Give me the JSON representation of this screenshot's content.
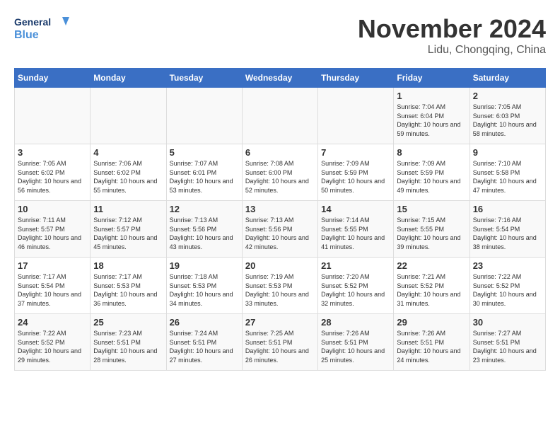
{
  "header": {
    "logo_line1": "General",
    "logo_line2": "Blue",
    "month": "November 2024",
    "location": "Lidu, Chongqing, China"
  },
  "weekdays": [
    "Sunday",
    "Monday",
    "Tuesday",
    "Wednesday",
    "Thursday",
    "Friday",
    "Saturday"
  ],
  "weeks": [
    [
      {
        "day": "",
        "sunrise": "",
        "sunset": "",
        "daylight": ""
      },
      {
        "day": "",
        "sunrise": "",
        "sunset": "",
        "daylight": ""
      },
      {
        "day": "",
        "sunrise": "",
        "sunset": "",
        "daylight": ""
      },
      {
        "day": "",
        "sunrise": "",
        "sunset": "",
        "daylight": ""
      },
      {
        "day": "",
        "sunrise": "",
        "sunset": "",
        "daylight": ""
      },
      {
        "day": "1",
        "sunrise": "Sunrise: 7:04 AM",
        "sunset": "Sunset: 6:04 PM",
        "daylight": "Daylight: 10 hours and 59 minutes."
      },
      {
        "day": "2",
        "sunrise": "Sunrise: 7:05 AM",
        "sunset": "Sunset: 6:03 PM",
        "daylight": "Daylight: 10 hours and 58 minutes."
      }
    ],
    [
      {
        "day": "3",
        "sunrise": "Sunrise: 7:05 AM",
        "sunset": "Sunset: 6:02 PM",
        "daylight": "Daylight: 10 hours and 56 minutes."
      },
      {
        "day": "4",
        "sunrise": "Sunrise: 7:06 AM",
        "sunset": "Sunset: 6:02 PM",
        "daylight": "Daylight: 10 hours and 55 minutes."
      },
      {
        "day": "5",
        "sunrise": "Sunrise: 7:07 AM",
        "sunset": "Sunset: 6:01 PM",
        "daylight": "Daylight: 10 hours and 53 minutes."
      },
      {
        "day": "6",
        "sunrise": "Sunrise: 7:08 AM",
        "sunset": "Sunset: 6:00 PM",
        "daylight": "Daylight: 10 hours and 52 minutes."
      },
      {
        "day": "7",
        "sunrise": "Sunrise: 7:09 AM",
        "sunset": "Sunset: 5:59 PM",
        "daylight": "Daylight: 10 hours and 50 minutes."
      },
      {
        "day": "8",
        "sunrise": "Sunrise: 7:09 AM",
        "sunset": "Sunset: 5:59 PM",
        "daylight": "Daylight: 10 hours and 49 minutes."
      },
      {
        "day": "9",
        "sunrise": "Sunrise: 7:10 AM",
        "sunset": "Sunset: 5:58 PM",
        "daylight": "Daylight: 10 hours and 47 minutes."
      }
    ],
    [
      {
        "day": "10",
        "sunrise": "Sunrise: 7:11 AM",
        "sunset": "Sunset: 5:57 PM",
        "daylight": "Daylight: 10 hours and 46 minutes."
      },
      {
        "day": "11",
        "sunrise": "Sunrise: 7:12 AM",
        "sunset": "Sunset: 5:57 PM",
        "daylight": "Daylight: 10 hours and 45 minutes."
      },
      {
        "day": "12",
        "sunrise": "Sunrise: 7:13 AM",
        "sunset": "Sunset: 5:56 PM",
        "daylight": "Daylight: 10 hours and 43 minutes."
      },
      {
        "day": "13",
        "sunrise": "Sunrise: 7:13 AM",
        "sunset": "Sunset: 5:56 PM",
        "daylight": "Daylight: 10 hours and 42 minutes."
      },
      {
        "day": "14",
        "sunrise": "Sunrise: 7:14 AM",
        "sunset": "Sunset: 5:55 PM",
        "daylight": "Daylight: 10 hours and 41 minutes."
      },
      {
        "day": "15",
        "sunrise": "Sunrise: 7:15 AM",
        "sunset": "Sunset: 5:55 PM",
        "daylight": "Daylight: 10 hours and 39 minutes."
      },
      {
        "day": "16",
        "sunrise": "Sunrise: 7:16 AM",
        "sunset": "Sunset: 5:54 PM",
        "daylight": "Daylight: 10 hours and 38 minutes."
      }
    ],
    [
      {
        "day": "17",
        "sunrise": "Sunrise: 7:17 AM",
        "sunset": "Sunset: 5:54 PM",
        "daylight": "Daylight: 10 hours and 37 minutes."
      },
      {
        "day": "18",
        "sunrise": "Sunrise: 7:17 AM",
        "sunset": "Sunset: 5:53 PM",
        "daylight": "Daylight: 10 hours and 36 minutes."
      },
      {
        "day": "19",
        "sunrise": "Sunrise: 7:18 AM",
        "sunset": "Sunset: 5:53 PM",
        "daylight": "Daylight: 10 hours and 34 minutes."
      },
      {
        "day": "20",
        "sunrise": "Sunrise: 7:19 AM",
        "sunset": "Sunset: 5:53 PM",
        "daylight": "Daylight: 10 hours and 33 minutes."
      },
      {
        "day": "21",
        "sunrise": "Sunrise: 7:20 AM",
        "sunset": "Sunset: 5:52 PM",
        "daylight": "Daylight: 10 hours and 32 minutes."
      },
      {
        "day": "22",
        "sunrise": "Sunrise: 7:21 AM",
        "sunset": "Sunset: 5:52 PM",
        "daylight": "Daylight: 10 hours and 31 minutes."
      },
      {
        "day": "23",
        "sunrise": "Sunrise: 7:22 AM",
        "sunset": "Sunset: 5:52 PM",
        "daylight": "Daylight: 10 hours and 30 minutes."
      }
    ],
    [
      {
        "day": "24",
        "sunrise": "Sunrise: 7:22 AM",
        "sunset": "Sunset: 5:52 PM",
        "daylight": "Daylight: 10 hours and 29 minutes."
      },
      {
        "day": "25",
        "sunrise": "Sunrise: 7:23 AM",
        "sunset": "Sunset: 5:51 PM",
        "daylight": "Daylight: 10 hours and 28 minutes."
      },
      {
        "day": "26",
        "sunrise": "Sunrise: 7:24 AM",
        "sunset": "Sunset: 5:51 PM",
        "daylight": "Daylight: 10 hours and 27 minutes."
      },
      {
        "day": "27",
        "sunrise": "Sunrise: 7:25 AM",
        "sunset": "Sunset: 5:51 PM",
        "daylight": "Daylight: 10 hours and 26 minutes."
      },
      {
        "day": "28",
        "sunrise": "Sunrise: 7:26 AM",
        "sunset": "Sunset: 5:51 PM",
        "daylight": "Daylight: 10 hours and 25 minutes."
      },
      {
        "day": "29",
        "sunrise": "Sunrise: 7:26 AM",
        "sunset": "Sunset: 5:51 PM",
        "daylight": "Daylight: 10 hours and 24 minutes."
      },
      {
        "day": "30",
        "sunrise": "Sunrise: 7:27 AM",
        "sunset": "Sunset: 5:51 PM",
        "daylight": "Daylight: 10 hours and 23 minutes."
      }
    ]
  ]
}
